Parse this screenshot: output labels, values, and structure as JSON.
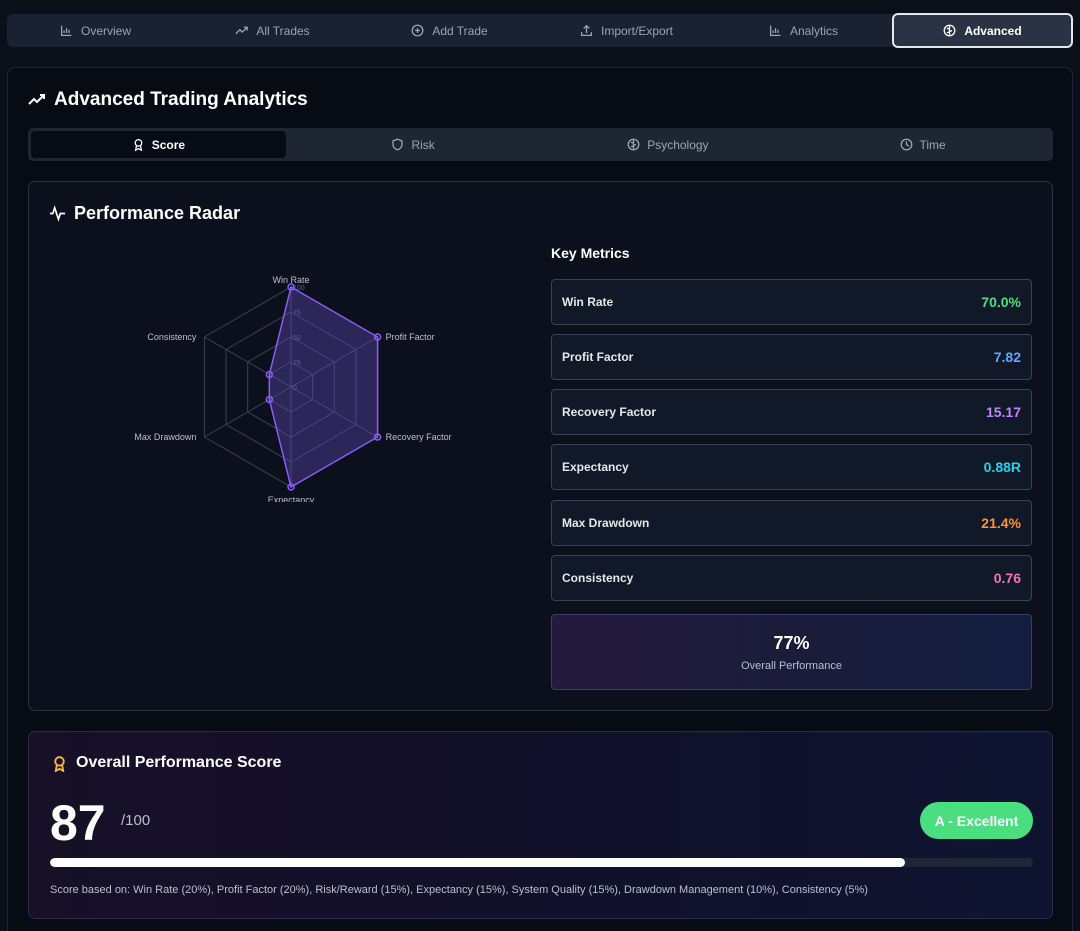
{
  "topnav": [
    {
      "label": "Overview",
      "icon": "bar-chart-icon"
    },
    {
      "label": "All Trades",
      "icon": "trend-up-icon"
    },
    {
      "label": "Add Trade",
      "icon": "plus-circle-icon"
    },
    {
      "label": "Import/Export",
      "icon": "upload-icon"
    },
    {
      "label": "Analytics",
      "icon": "bar-chart-icon"
    },
    {
      "label": "Advanced",
      "icon": "brain-icon",
      "active": true
    }
  ],
  "panel": {
    "title": "Advanced Trading Analytics"
  },
  "subtabs": [
    {
      "label": "Score",
      "icon": "award-icon",
      "active": true
    },
    {
      "label": "Risk",
      "icon": "shield-icon"
    },
    {
      "label": "Psychology",
      "icon": "brain-icon"
    },
    {
      "label": "Time",
      "icon": "clock-icon"
    }
  ],
  "radar": {
    "title": "Performance Radar",
    "ticks": [
      "0",
      "25",
      "50",
      "75",
      "100"
    ]
  },
  "chart_data": {
    "type": "radar",
    "axes": [
      "Win Rate",
      "Profit Factor",
      "Recovery Factor",
      "Expectancy",
      "Max Drawdown",
      "Consistency"
    ],
    "values": [
      100,
      100,
      100,
      100,
      25,
      25
    ],
    "range": [
      0,
      100
    ],
    "colors": {
      "stroke": "#8b5cf6",
      "fill": "#6d4fc9"
    }
  },
  "metrics": {
    "title": "Key Metrics",
    "items": [
      {
        "label": "Win Rate",
        "value": "70.0%",
        "color": "#4ade80"
      },
      {
        "label": "Profit Factor",
        "value": "7.82",
        "color": "#60a5fa"
      },
      {
        "label": "Recovery Factor",
        "value": "15.17",
        "color": "#c084fc"
      },
      {
        "label": "Expectancy",
        "value": "0.88R",
        "color": "#22d3ee"
      },
      {
        "label": "Max Drawdown",
        "value": "21.4%",
        "color": "#fb923c"
      },
      {
        "label": "Consistency",
        "value": "0.76",
        "color": "#f472b6"
      }
    ],
    "overall_value": "77%",
    "overall_label": "Overall Performance"
  },
  "score": {
    "title": "Overall Performance Score",
    "value": "87",
    "denominator": "/100",
    "progress": 0.87,
    "grade": "A - Excellent",
    "note": "Score based on: Win Rate (20%), Profit Factor (20%), Risk/Reward (15%), Expectancy (15%), System Quality (15%), Drawdown Management (10%), Consistency (5%)"
  }
}
